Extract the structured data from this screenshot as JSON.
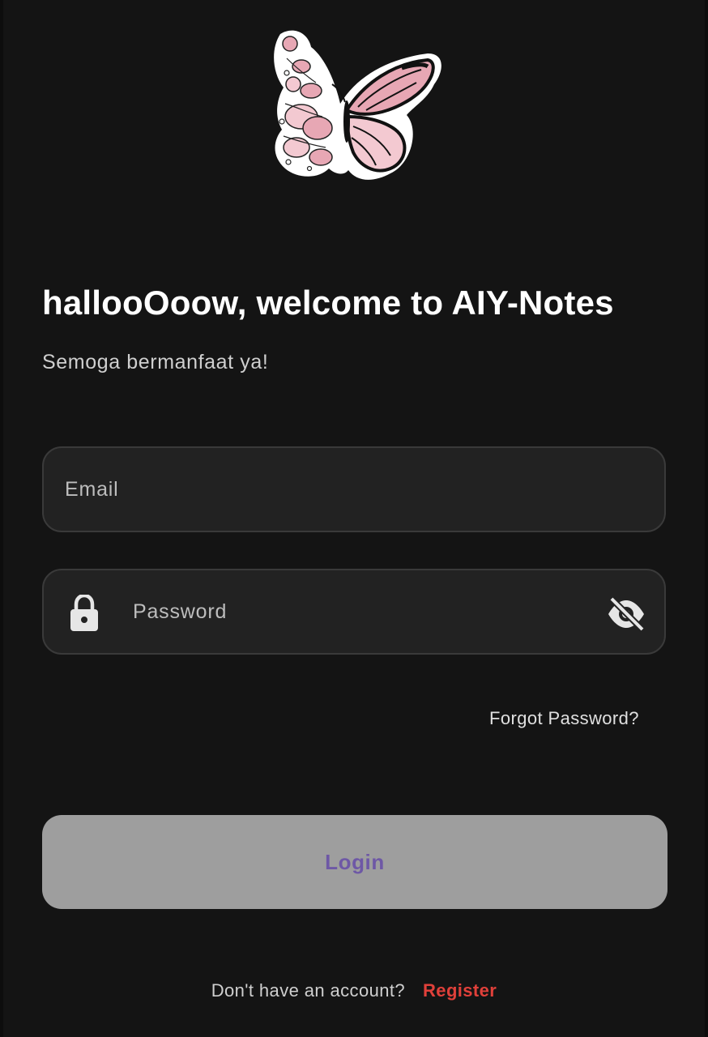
{
  "logo": {
    "icon": "butterfly-floral-logo",
    "colors": {
      "pink": "#e7a7b4",
      "light_pink": "#f3c9d1",
      "outline": "#111111"
    }
  },
  "header": {
    "title": "hallooOoow, welcome to AIY-Notes",
    "subtitle": "Semoga bermanfaat ya!"
  },
  "form": {
    "email": {
      "placeholder": "Email",
      "value": ""
    },
    "password": {
      "placeholder": "Password",
      "value": "",
      "leading_icon": "lock-icon",
      "trailing_icon": "eye-off-icon"
    },
    "forgot_label": "Forgot Password?",
    "login_label": "Login"
  },
  "footer": {
    "question": "Don't have an account?",
    "register_label": "Register"
  },
  "colors": {
    "background": "#141414",
    "field_background": "#222222",
    "button_background": "#9e9e9e",
    "button_text": "#6e58a6",
    "register": "#e0403a"
  }
}
